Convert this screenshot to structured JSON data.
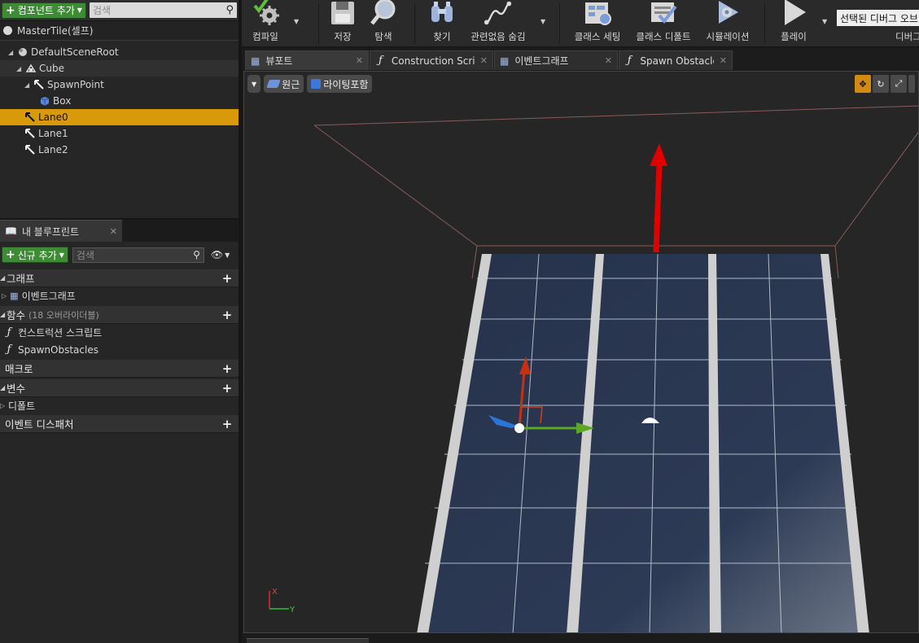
{
  "components_panel": {
    "add_component_label": "컴포넌트 추가",
    "search_placeholder": "검색",
    "self_label": "MasterTile(셀프)",
    "tree": [
      {
        "label": "DefaultSceneRoot",
        "icon": "scene-root-icon"
      },
      {
        "label": "Cube",
        "icon": "static-mesh-icon"
      },
      {
        "label": "SpawnPoint",
        "icon": "arrow-component-icon"
      },
      {
        "label": "Box",
        "icon": "box-collision-icon"
      },
      {
        "label": "Lane0",
        "icon": "arrow-component-icon"
      },
      {
        "label": "Lane1",
        "icon": "arrow-component-icon"
      },
      {
        "label": "Lane2",
        "icon": "arrow-component-icon"
      }
    ]
  },
  "my_blueprint": {
    "tab_label": "내 블루프린트",
    "add_new_label": "신규 추가",
    "search_placeholder": "검색",
    "categories": {
      "graphs": "그래프",
      "event_graph": "이벤트그래프",
      "functions": "함수",
      "functions_count": "(18 오버라이더블)",
      "construction_script": "컨스트럭션 스크립트",
      "spawn_obstacles": "SpawnObstacles",
      "macros": "매크로",
      "variables": "변수",
      "defaults": "디폴트",
      "event_dispatchers": "이벤트 디스패처"
    }
  },
  "toolbar": {
    "compile": "컴파일",
    "save": "저장",
    "browse": "탐색",
    "find": "찾기",
    "hide_unrelated": "관련없음 숨김",
    "class_settings": "클래스 세팅",
    "class_defaults": "클래스 디폴트",
    "simulation": "시뮬레이션",
    "play": "플레이",
    "debug_object_select": "선택된 디버그 오브",
    "debug_label": "디버그"
  },
  "document_tabs": [
    {
      "label": "뷰포트",
      "icon": "viewport-icon"
    },
    {
      "label": "Construction Scrip",
      "icon": "function-icon"
    },
    {
      "label": "이벤트그래프",
      "icon": "event-graph-icon"
    },
    {
      "label": "Spawn Obstacles",
      "icon": "function-icon"
    }
  ],
  "viewport": {
    "perspective_label": "원근",
    "lighting_label": "라이팅포함",
    "axis_x": "X",
    "axis_y": "Y"
  }
}
